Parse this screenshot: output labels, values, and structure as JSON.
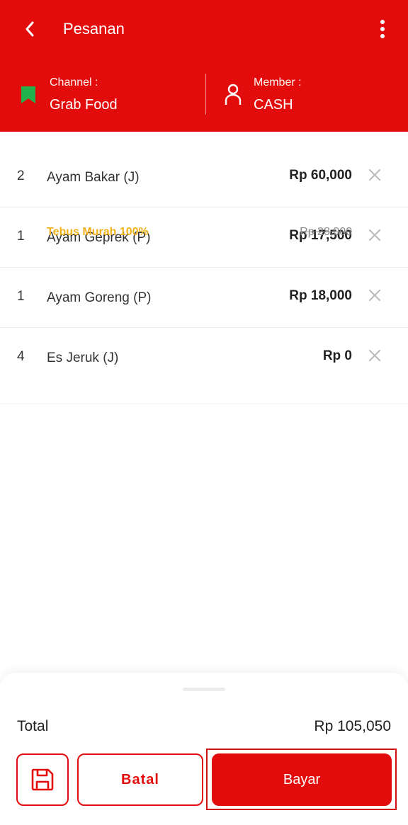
{
  "header": {
    "title": "Pesanan",
    "channel_label": "Channel :",
    "channel_value": "Grab Food",
    "member_label": "Member :",
    "member_value": "CASH"
  },
  "items": [
    {
      "qty": "2",
      "name": "Ayam Bakar (J)",
      "price": "Rp 60,000"
    },
    {
      "qty": "1",
      "name": "Ayam Geprek (P)",
      "price": "Rp 17,500"
    },
    {
      "qty": "1",
      "name": "Ayam Goreng (P)",
      "price": "Rp 18,000"
    },
    {
      "qty": "4",
      "name": "Es Jeruk (J)",
      "price": "Rp 0",
      "promo": "Tebus Murah 100%",
      "original_price": "Rp 28,000"
    }
  ],
  "footer": {
    "total_label": "Total",
    "total_value": "Rp 105,050",
    "cancel_label": "Batal",
    "pay_label": "Bayar"
  },
  "colors": {
    "primary": "#e30c0c",
    "promo": "#f2b21b",
    "channel_icon": "#21b24b"
  },
  "icons": [
    "back-arrow-icon",
    "more-vertical-icon",
    "bookmark-icon",
    "user-icon",
    "close-icon",
    "save-icon"
  ]
}
